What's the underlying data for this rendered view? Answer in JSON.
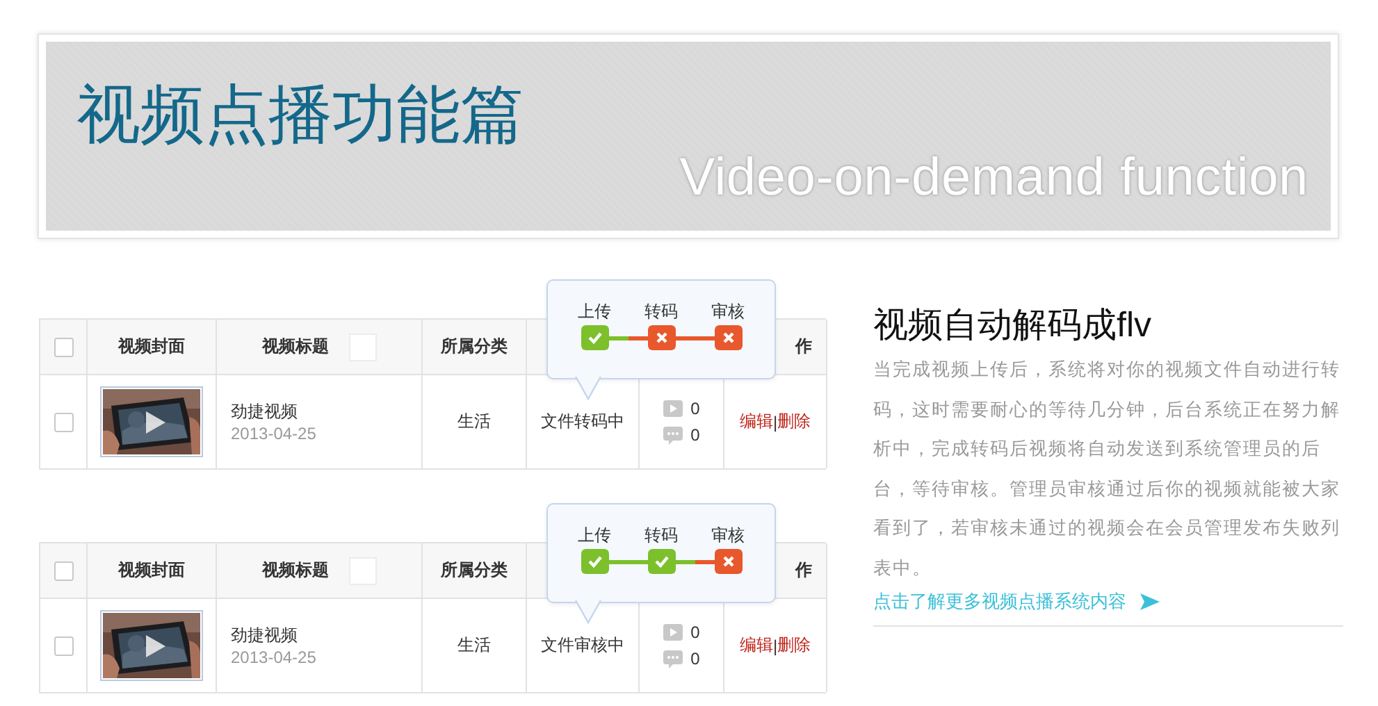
{
  "banner": {
    "title": "视频点播功能篇",
    "subtitle": "Video-on-demand function"
  },
  "tables": [
    {
      "header": {
        "checked": false,
        "cover": "视频封面",
        "title": "视频标题",
        "category": "所属分类",
        "column_6": "作"
      },
      "row": {
        "checked": false,
        "kind": "picture",
        "title": "劲捷视频",
        "date": "2013-04-25",
        "category": "生活",
        "status": "文件转码中",
        "plays": "0",
        "comments": "0",
        "edit": "编辑",
        "separator": "|",
        "delete": "删除"
      },
      "tooltip": {
        "stages": [
          {
            "label": "上传",
            "done": true
          },
          {
            "label": "转码",
            "done": false
          },
          {
            "label": "审核",
            "done": false
          }
        ]
      }
    },
    {
      "header": {
        "checked": false,
        "cover": "视频封面",
        "title": "视频标题",
        "category": "所属分类",
        "column_6": "作"
      },
      "row": {
        "checked": false,
        "kind": "picture",
        "title": "劲捷视频",
        "date": "2013-04-25",
        "category": "生活",
        "status": "文件审核中",
        "plays": "0",
        "comments": "0",
        "edit": "编辑",
        "separator": "|",
        "delete": "删除"
      },
      "tooltip": {
        "stages": [
          {
            "label": "上传",
            "done": true
          },
          {
            "label": "转码",
            "done": true
          },
          {
            "label": "审核",
            "done": false
          }
        ]
      }
    }
  ],
  "info": {
    "heading": "视频自动解码成flv",
    "body": "当完成视频上传后，系统将对你的视频文件自动进行转码，这时需要耐心的等待几分钟，后台系统正在努力解析中，完成转码后视频将自动发送到系统管理员的后台，等待审核。管理员审核通过后你的视频就能被大家看到了，若审核未通过的视频会在会员管理发布失败列表中。",
    "link": "点击了解更多视频点播系统内容"
  }
}
